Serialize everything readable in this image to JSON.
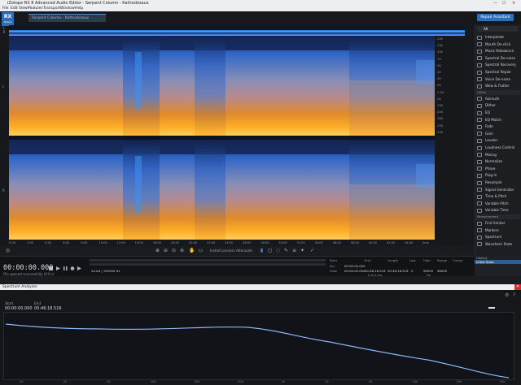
{
  "window": {
    "title": "iZotope RX 8 Advanced Audio Editor - Serpent Column - Kathodosaux",
    "controls": [
      "—",
      "☐",
      "✕"
    ]
  },
  "menu": [
    "File",
    "Edit",
    "View",
    "Modules",
    "Transport",
    "Window",
    "Help"
  ],
  "logo": {
    "text": "RX",
    "sub": "iZotope"
  },
  "tab": {
    "label": "Serpent Column - Kathodosaux"
  },
  "repair_assistant": "Repair Assistant",
  "channels": [
    "L",
    "R"
  ],
  "freq_ticks": [
    "-20k",
    "-15k",
    "-10k",
    "-7k",
    "-5k",
    "-4k",
    "-3k",
    "-2k",
    "-1.5k",
    "-1k",
    "-700",
    "-500",
    "-300",
    "-200",
    "-100"
  ],
  "time_ticks": [
    "0:00",
    "2:00",
    "4:00",
    "6:00",
    "8:00",
    "10:00",
    "12:00",
    "14:00",
    "16:00",
    "18:00",
    "20:00",
    "22:00",
    "24:00",
    "26:00",
    "28:00",
    "30:00",
    "32:00",
    "34:00",
    "36:00",
    "38:00",
    "40:00",
    "42:00",
    "44:00",
    "hms"
  ],
  "modules": {
    "filter_label": "All",
    "repair": [
      "Interpolate",
      "Mouth De-click",
      "Music Rebalance",
      "Spectral De-noise",
      "Spectral Recovery",
      "Spectral Repair",
      "Voice De-noise",
      "Wow & Flutter"
    ],
    "utility_label": "Utility",
    "utility": [
      "Azimuth",
      "Dither",
      "EQ",
      "EQ Match",
      "Fade",
      "Gain",
      "Leveler",
      "Loudness Control",
      "Mixing",
      "Normalize",
      "Phase",
      "Plug-in",
      "Resample",
      "Signal Generator",
      "Time & Pitch",
      "Variable Pitch",
      "Variable Time"
    ],
    "measurement_label": "Measurement",
    "measurement": [
      "Find Similar",
      "Markers",
      "Spectrum",
      "Waveform Stats"
    ]
  },
  "history": {
    "header": "History",
    "state": "Initial State"
  },
  "toolbar": {
    "instant_process": "Instant process",
    "mode": "Attenuate"
  },
  "transport": {
    "timecode": "00:00:00.000",
    "status": "File opened successfully (0.0 s)",
    "sel_label": "Sel",
    "view_label": "View",
    "start_label": "Start",
    "end_label": "End",
    "length_label": "Length",
    "low_label": "Low",
    "high_label": "High",
    "range_label": "Range",
    "cursor_label": "Cursor",
    "sel_start": "00:00:00.000",
    "view_start": "00:00:00.000",
    "view_end": "00:46:18.516",
    "view_length": "00:46:18.516",
    "low": "0",
    "high": "96000",
    "range": "96000",
    "format": "24-bit | 192000 Hz",
    "time_format": "h:m:s.ms",
    "freq_unit": "Hz"
  },
  "spectrum_analyzer": {
    "title": "Spectrum Analyzer",
    "start_label": "Start",
    "end_label": "End",
    "start": "00:00:00.000",
    "end": "00:46:18.516",
    "x_ticks": [
      "10",
      "20",
      "50",
      "100",
      "200",
      "500",
      "1k",
      "2k",
      "5k",
      "10k",
      "20k",
      "50k"
    ]
  },
  "colors": {
    "accent": "#2f6fb8",
    "spectrogram_hot": "#f0a030",
    "spectrogram_cool": "#2a5fb8"
  }
}
